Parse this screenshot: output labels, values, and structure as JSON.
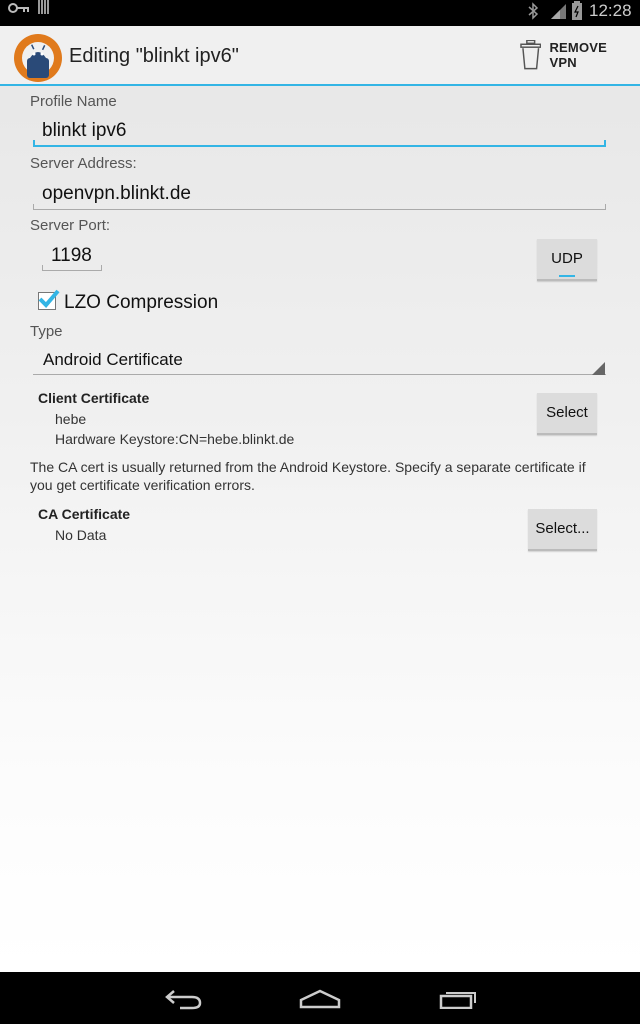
{
  "status_bar": {
    "time": "12:28",
    "icons": [
      "key-icon",
      "bars-icon",
      "bluetooth-icon",
      "signal-icon",
      "battery-icon"
    ]
  },
  "action_bar": {
    "title": "Editing \"blinkt ipv6\"",
    "remove_label": "REMOVE VPN",
    "accent_color": "#33b5e5"
  },
  "form": {
    "profile_name_label": "Profile Name",
    "profile_name_value": "blinkt ipv6",
    "server_address_label": "Server Address:",
    "server_address_value": "openvpn.blinkt.de",
    "server_port_label": "Server Port:",
    "server_port_value": "1198",
    "protocol_button": "UDP",
    "lzo_label": "LZO Compression",
    "lzo_checked": true,
    "type_label": "Type",
    "type_value": "Android Certificate"
  },
  "client_cert": {
    "title": "Client Certificate",
    "alias": "hebe",
    "detail": "Hardware Keystore:CN=hebe.blinkt.de",
    "button": "Select"
  },
  "ca_help": "The CA cert is usually returned from the Android Keystore. Specify a separate certificate if you get certificate verification errors.",
  "ca_cert": {
    "title": "CA Certificate",
    "value": "No Data",
    "button": "Select..."
  },
  "nav_bar": {
    "icons": [
      "back-icon",
      "home-icon",
      "recent-apps-icon"
    ]
  }
}
